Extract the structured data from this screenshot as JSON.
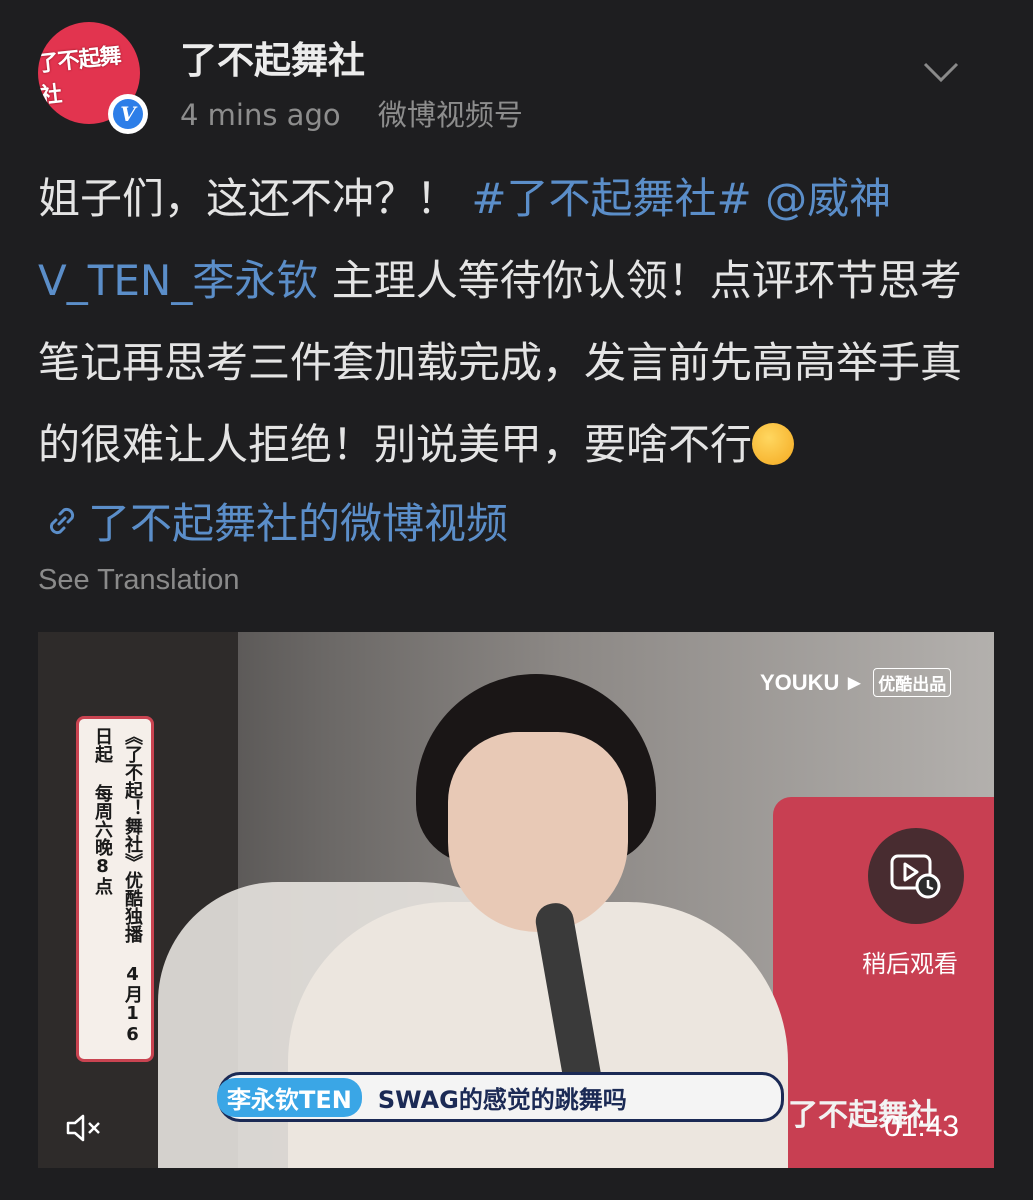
{
  "post": {
    "avatar_text": "了不起舞社",
    "verified_mark": "V",
    "username": "了不起舞社",
    "time": "4  mins ago",
    "source": "微博视频号",
    "text_part1": "姐子们，这还不冲？！ ",
    "hashtag": "#了不起舞社#",
    "mention": " @威神V_TEN_李永钦",
    "text_part2": " 主理人等待你认领！点评环节思考笔记再思考三件套加载完成，发言前先高高举手真的很难让人拒绝！别说美甲，要啥不行",
    "video_link_text": "了不起舞社的微博视频",
    "see_translation": "See Translation"
  },
  "video": {
    "watermark": "YOUKU",
    "watermark_badge": "优酷出品",
    "banner_text": "《了不起！舞社》优酷独播 4月16日起 每周六晚8点",
    "watch_later_label": "稍后观看",
    "subtitle_name": "李永钦TEN",
    "subtitle_text": "SWAG的感觉的跳舞吗",
    "brand_watermark": "了不起舞社",
    "duration": "01:43"
  },
  "colors": {
    "background": "#1e1e20",
    "link": "#5b8ec9",
    "avatar": "#e2344f",
    "verified": "#2d7ee8"
  },
  "icons": [
    "chevron-down-icon",
    "link-icon",
    "watch-later-icon",
    "mute-icon",
    "verified-icon"
  ]
}
